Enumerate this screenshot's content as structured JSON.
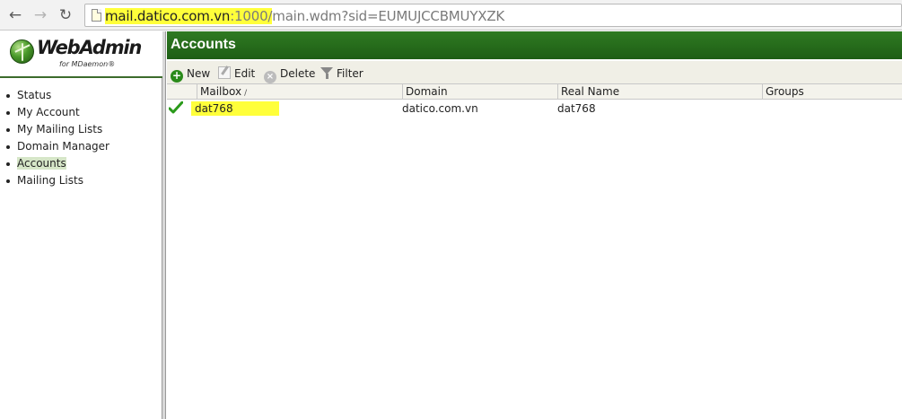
{
  "browser": {
    "back_glyph": "←",
    "forward_glyph": "→",
    "reload_glyph": "↻",
    "url_host": "mail.datico.com.vn",
    "url_port": ":1000/",
    "url_path": "main.wdm?sid=EUMUJCCBMUYXZK",
    "highlight_color": "#ffff3a"
  },
  "logo": {
    "title": "WebAdmin",
    "subtitle": "for MDaemon®"
  },
  "nav": {
    "items": [
      {
        "label": "Status"
      },
      {
        "label": "My Account"
      },
      {
        "label": "My Mailing Lists"
      },
      {
        "label": "Domain Manager"
      },
      {
        "label": "Accounts",
        "active": true
      },
      {
        "label": "Mailing Lists"
      }
    ]
  },
  "header": {
    "title": "Accounts",
    "color": "#256b1b"
  },
  "toolbar": {
    "new_label": "New",
    "edit_label": "Edit",
    "delete_label": "Delete",
    "filter_label": "Filter",
    "new_icon": "add-circle-icon",
    "edit_icon": "edit-icon",
    "delete_icon": "delete-circle-icon",
    "filter_icon": "funnel-icon"
  },
  "grid": {
    "columns": [
      {
        "label": "Mailbox",
        "sort": "asc"
      },
      {
        "label": "Domain"
      },
      {
        "label": "Real Name"
      },
      {
        "label": "Groups"
      }
    ],
    "sort_glyph": "/",
    "rows": [
      {
        "status_icon": "green-check-icon",
        "mailbox": "dat768",
        "domain": "datico.com.vn",
        "real_name": "dat768",
        "groups": ""
      }
    ]
  }
}
